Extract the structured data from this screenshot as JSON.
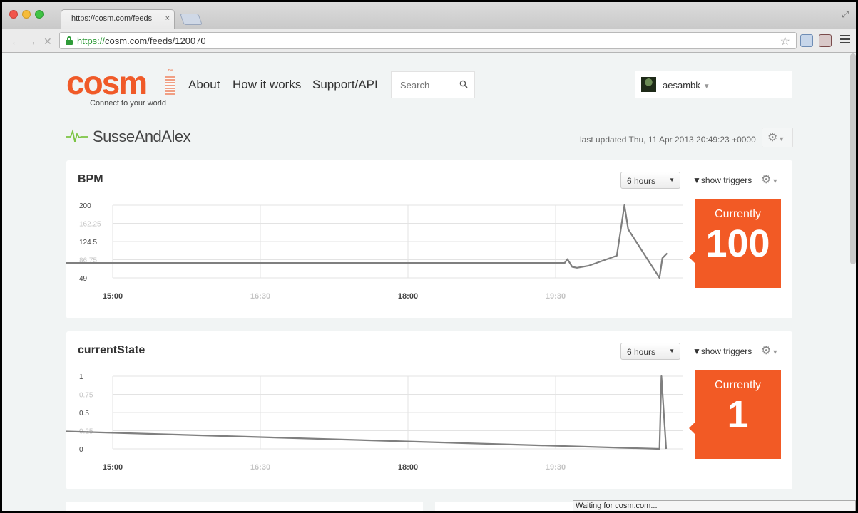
{
  "browser": {
    "tab_title": "https://cosm.com/feeds",
    "tab_close": "×",
    "url_scheme": "https://",
    "url_rest": "cosm.com/feeds/120070",
    "status": "Waiting for cosm.com..."
  },
  "header": {
    "logo": "cosm",
    "tagline": "Connect to your world",
    "nav": [
      "About",
      "How it works",
      "Support/API"
    ],
    "search_placeholder": "Search",
    "username": "aesambk"
  },
  "feed": {
    "title": "SusseAndAlex",
    "last_updated": "last updated Thu, 11 Apr 2013 20:49:23 +0000"
  },
  "colors": {
    "accent": "#f25a25",
    "line": "#7f7f7f",
    "grid": "#e3e3e3"
  },
  "datastreams": [
    {
      "title": "BPM",
      "timeframe": "6 hours",
      "triggers_label": "show triggers",
      "current_label": "Currently",
      "current_value": "100"
    },
    {
      "title": "currentState",
      "timeframe": "6 hours",
      "triggers_label": "show triggers",
      "current_label": "Currently",
      "current_value": "1"
    }
  ],
  "chart_data": [
    {
      "type": "line",
      "title": "BPM",
      "x_ticks": [
        "15:00",
        "16:30",
        "18:00",
        "19:30"
      ],
      "y_ticks": [
        "200",
        "162.25",
        "124.5",
        "86.75",
        "49"
      ],
      "ylim": [
        49,
        200
      ],
      "x_unit": "hours",
      "xlim": [
        14.3,
        20.8
      ],
      "grid": true,
      "series": [
        {
          "x": [
            14.3,
            19.55,
            19.58,
            19.63,
            19.68,
            19.8,
            20.1,
            20.15,
            20.18,
            20.22,
            20.55,
            20.58,
            20.63
          ],
          "y": [
            80,
            80,
            88,
            72,
            70,
            74,
            95,
            160,
            200,
            150,
            49,
            90,
            100
          ]
        }
      ]
    },
    {
      "type": "line",
      "title": "currentState",
      "x_ticks": [
        "15:00",
        "16:30",
        "18:00",
        "19:30"
      ],
      "y_ticks": [
        "1",
        "0.75",
        "0.5",
        "0.25",
        "0"
      ],
      "ylim": [
        0,
        1
      ],
      "x_unit": "hours",
      "xlim": [
        14.3,
        20.8
      ],
      "grid": true,
      "series": [
        {
          "x": [
            14.3,
            20.55,
            20.57,
            20.62
          ],
          "y": [
            0.24,
            0.0,
            1.0,
            0.0
          ]
        }
      ]
    }
  ]
}
